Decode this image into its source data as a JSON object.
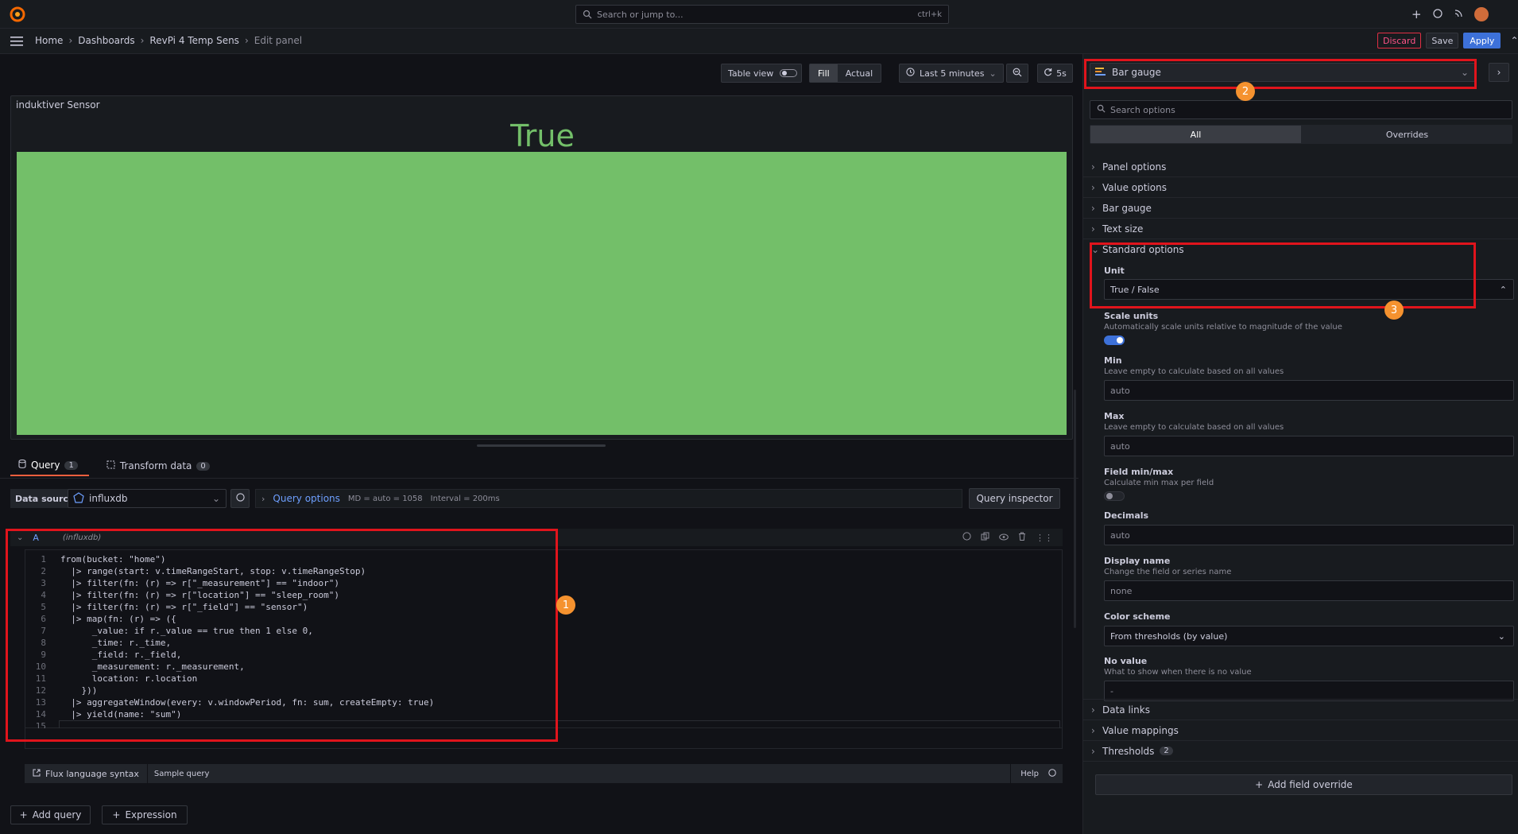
{
  "topbar": {
    "search_placeholder": "Search or jump to...",
    "shortcut": "ctrl+k"
  },
  "breadcrumb": [
    "Home",
    "Dashboards",
    "RevPi 4 Temp Sens",
    "Edit panel"
  ],
  "actions": {
    "discard": "Discard",
    "save": "Save",
    "apply": "Apply"
  },
  "toolbar": {
    "table_view": "Table view",
    "fill": "Fill",
    "actual": "Actual",
    "time_range": "Last 5 minutes",
    "refresh": "5s"
  },
  "panel": {
    "title": "induktiver Sensor",
    "value": "True",
    "bar_color": "#73bf69"
  },
  "query_tabs": [
    {
      "label": "Query",
      "count": "1"
    },
    {
      "label": "Transform data",
      "count": "0"
    }
  ],
  "query_bar": {
    "data_source_label": "Data source",
    "data_source": "influxdb",
    "query_options": "Query options",
    "md": "MD = auto = 1058",
    "interval": "Interval = 200ms",
    "inspector": "Query inspector"
  },
  "query": {
    "ref": "A",
    "ds": "(influxdb)",
    "lines": [
      "from(bucket: \"home\")",
      "  |> range(start: v.timeRangeStart, stop: v.timeRangeStop)",
      "  |> filter(fn: (r) => r[\"_measurement\"] == \"indoor\")",
      "  |> filter(fn: (r) => r[\"location\"] == \"sleep_room\")",
      "  |> filter(fn: (r) => r[\"_field\"] == \"sensor\")",
      "  |> map(fn: (r) => ({",
      "      _value: if r._value == true then 1 else 0,",
      "      _time: r._time,",
      "      _field: r._field,",
      "      _measurement: r._measurement,",
      "      location: r.location",
      "    }))",
      "  |> aggregateWindow(every: v.windowPeriod, fn: sum, createEmpty: true)",
      "  |> yield(name: \"sum\")",
      ""
    ],
    "line_numbers": [
      "1",
      "2",
      "3",
      "4",
      "5",
      "6",
      "7",
      "8",
      "9",
      "10",
      "11",
      "12",
      "13",
      "14",
      "15"
    ]
  },
  "query_footer": {
    "flux_syntax": "Flux language syntax",
    "sample_query": "Sample query",
    "help": "Help",
    "add_query": "Add query",
    "expression": "Expression"
  },
  "options": {
    "visualization": "Bar gauge",
    "search_placeholder": "Search options",
    "tabs": [
      "All",
      "Overrides"
    ],
    "groups_top": [
      "Panel options",
      "Value options",
      "Bar gauge",
      "Text size"
    ],
    "standard_options": "Standard options",
    "unit_label": "Unit",
    "unit_value": "True / False",
    "scale_units_label": "Scale units",
    "scale_units_desc": "Automatically scale units relative to magnitude of the value",
    "min_label": "Min",
    "min_desc": "Leave empty to calculate based on all values",
    "min_placeholder": "auto",
    "max_label": "Max",
    "max_desc": "Leave empty to calculate based on all values",
    "max_placeholder": "auto",
    "field_minmax_label": "Field min/max",
    "field_minmax_desc": "Calculate min max per field",
    "decimals_label": "Decimals",
    "decimals_placeholder": "auto",
    "display_name_label": "Display name",
    "display_name_desc": "Change the field or series name",
    "display_name_placeholder": "none",
    "color_scheme_label": "Color scheme",
    "color_scheme_value": "From thresholds (by value)",
    "no_value_label": "No value",
    "no_value_desc": "What to show when there is no value",
    "no_value_placeholder": "-",
    "groups_bottom": [
      "Data links",
      "Value mappings",
      "Thresholds"
    ],
    "thresholds_count": "2",
    "add_override": "Add field override"
  },
  "annotations": [
    "1",
    "2",
    "3"
  ]
}
